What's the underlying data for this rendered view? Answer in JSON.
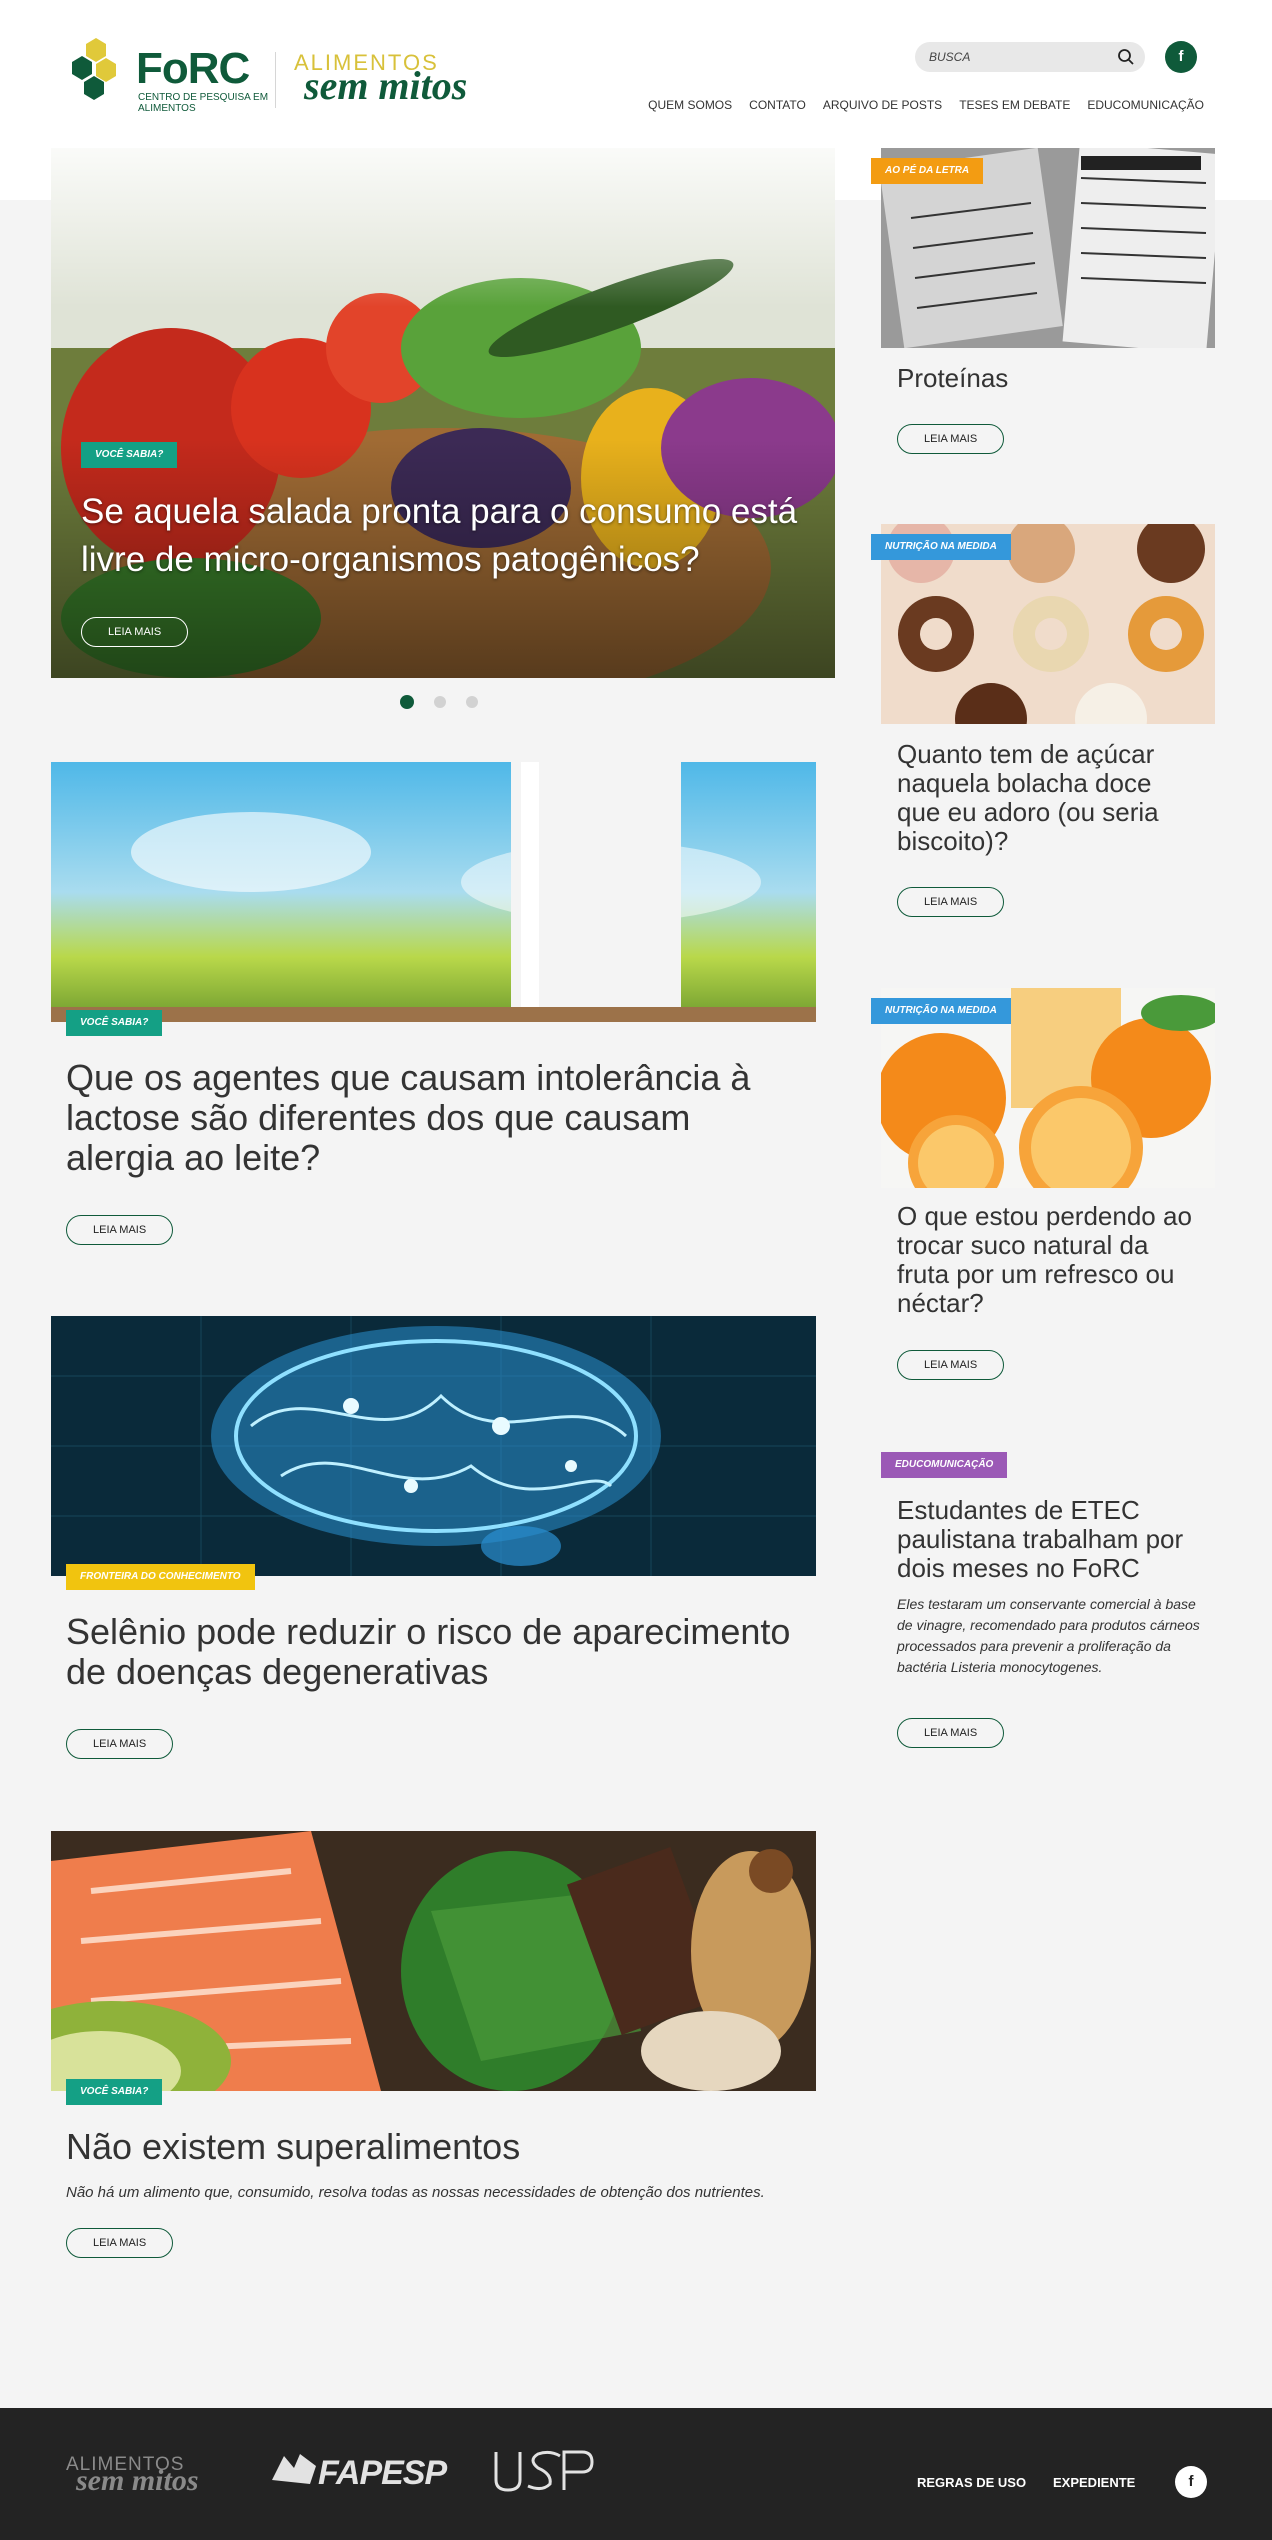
{
  "header": {
    "forc_logo": {
      "name": "FoRC",
      "subtitle": "Centro de Pesquisa em Alimentos"
    },
    "asm_logo": {
      "line1": "ALIMENTOS",
      "line2": "sem mitos"
    },
    "search": {
      "placeholder": "BUSCA",
      "icon": "search-icon"
    },
    "facebook": {
      "label": "f",
      "icon": "facebook-icon"
    },
    "nav": [
      "QUEM SOMOS",
      "CONTATO",
      "ARQUIVO DE POSTS",
      "TESES EM DEBATE",
      "EDUCOMUNICAÇÃO"
    ]
  },
  "hero": {
    "tag": "VOCÊ SABIA?",
    "title": "Se aquela salada pronta para o consumo está livre de micro-organismos patogênicos?",
    "button": "LEIA MAIS",
    "slides": {
      "count": 3,
      "active": 1
    }
  },
  "articles": [
    {
      "tag": "VOCÊ SABIA?",
      "title": "Que os agentes que causam intolerância à lactose são diferentes dos que causam alergia ao leite?",
      "button": "LEIA MAIS"
    },
    {
      "tag": "FRONTEIRA DO CONHECIMENTO",
      "title": "Selênio pode reduzir o risco de aparecimento de doenças degenerativas",
      "button": "LEIA MAIS"
    },
    {
      "tag": "VOCÊ SABIA?",
      "title": "Não existem superalimentos",
      "excerpt": "Não há um alimento que, consumido, resolva todas as nossas necessidades de obtenção dos nutrientes.",
      "button": "LEIA MAIS"
    }
  ],
  "sidebar": [
    {
      "tag": "AO PÉ DA LETRA",
      "title": "Proteínas",
      "button": "LEIA MAIS"
    },
    {
      "tag": "NUTRIÇÃO NA MEDIDA",
      "title": "Quanto tem de açúcar naquela bolacha doce que eu adoro (ou seria biscoito)?",
      "button": "LEIA MAIS"
    },
    {
      "tag": "NUTRIÇÃO NA MEDIDA",
      "title": "O que estou perdendo ao trocar suco natural da fruta por um refresco ou néctar?",
      "button": "LEIA MAIS"
    },
    {
      "tag": "EDUCOMUNICAÇÃO",
      "title": "Estudantes de ETEC paulistana trabalham por dois meses no FoRC",
      "excerpt": "Eles testaram um conservante comercial à base de vinagre, recomendado para produtos cárneos processados para prevenir a proliferação da bactéria Listeria monocytogenes.",
      "button": "LEIA MAIS"
    }
  ],
  "footer": {
    "asm_logo": {
      "line1": "ALIMENTOS",
      "line2": "sem mitos"
    },
    "fapesp": "FAPESP",
    "usp": "USP",
    "links": [
      "REGRAS DE USO",
      "EXPEDIENTE"
    ],
    "facebook": "f"
  },
  "colors": {
    "brand_green": "#0f5a3a",
    "tag_green": "#14a085",
    "tag_orange": "#f39c12",
    "tag_blue": "#3498db",
    "tag_yellow": "#f1c40f",
    "tag_purple": "#9b59b6",
    "footer_bg": "#232323"
  }
}
